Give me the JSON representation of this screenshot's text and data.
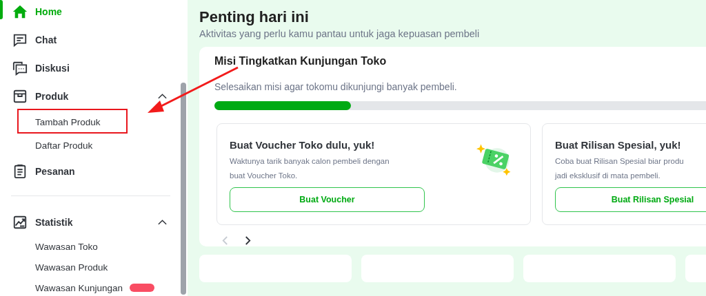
{
  "sidebar": {
    "items": [
      {
        "label": "Home",
        "selected": true
      },
      {
        "label": "Chat",
        "selected": false
      },
      {
        "label": "Diskusi",
        "selected": false
      },
      {
        "label": "Produk",
        "selected": false,
        "expanded": true,
        "children": [
          {
            "label": "Tambah Produk",
            "highlighted": true
          },
          {
            "label": "Daftar Produk",
            "highlighted": false
          }
        ]
      },
      {
        "label": "Pesanan",
        "selected": false
      },
      {
        "label": "Statistik",
        "selected": false,
        "divider_before": true,
        "expanded": true,
        "children": [
          {
            "label": "Wawasan Toko",
            "highlighted": false
          },
          {
            "label": "Wawasan Produk",
            "highlighted": false
          },
          {
            "label": "Wawasan Kunjungan",
            "highlighted": false,
            "new_badge": true
          }
        ]
      }
    ]
  },
  "main": {
    "title": "Penting hari ini",
    "subtitle": "Aktivitas yang perlu kamu pantau untuk jaga kepuasan pembeli",
    "mission": {
      "title": "Misi Tingkatkan Kunjungan Toko",
      "description": "Selesaikan misi agar tokomu dikunjungi banyak pembeli.",
      "level": 0.26,
      "cards": [
        {
          "title": "Buat Voucher Toko dulu, yuk!",
          "lines": [
            "Waktunya tarik banyak calon pembeli dengan",
            "buat Voucher Toko."
          ],
          "button": "Buat Voucher",
          "illustration": true
        },
        {
          "title": "Buat Rilisan Spesial, yuk!",
          "lines": [
            "Coba buat Rilisan Spesial biar produ",
            "jadi eksklusif di mata pembeli."
          ],
          "button": "Buat Rilisan Spesial"
        }
      ],
      "prev_disabled": true
    }
  }
}
